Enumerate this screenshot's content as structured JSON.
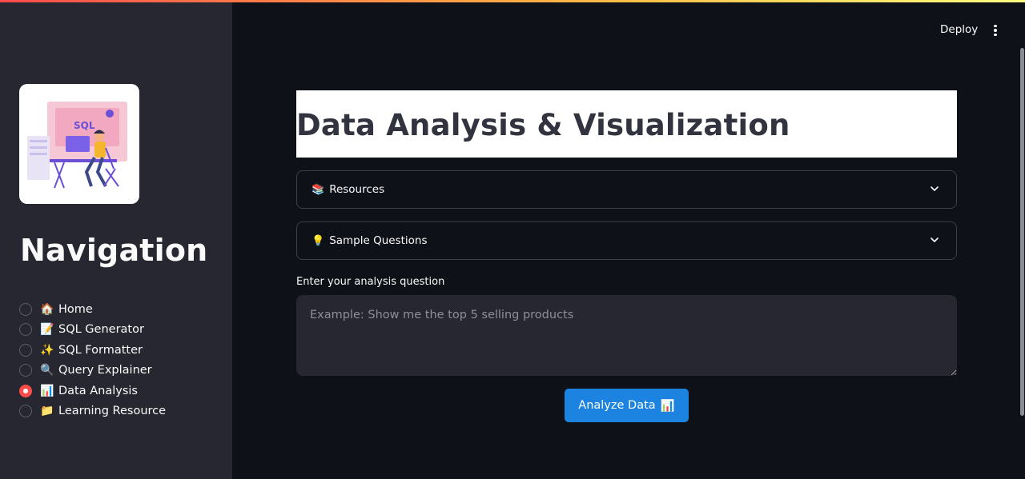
{
  "header": {
    "deploy_label": "Deploy",
    "menu_icon": "kebab-menu-icon"
  },
  "sidebar": {
    "logo_text": "SQL",
    "title": "Navigation",
    "items": [
      {
        "emoji": "🏠",
        "label": "Home",
        "selected": false
      },
      {
        "emoji": "📝",
        "label": "SQL Generator",
        "selected": false
      },
      {
        "emoji": "✨",
        "label": "SQL Formatter",
        "selected": false
      },
      {
        "emoji": "🔍",
        "label": "Query Explainer",
        "selected": false
      },
      {
        "emoji": "📊",
        "label": "Data Analysis",
        "selected": true
      },
      {
        "emoji": "📁",
        "label": "Learning Resource",
        "selected": false
      }
    ]
  },
  "main": {
    "title": "Data Analysis & Visualization",
    "expanders": [
      {
        "emoji": "📚",
        "label": "Resources"
      },
      {
        "emoji": "💡",
        "label": "Sample Questions"
      }
    ],
    "question_label": "Enter your analysis question",
    "question_placeholder": "Example: Show me the top 5 selling products",
    "question_value": "",
    "analyze_button": {
      "label": "Analyze Data",
      "emoji": "📊"
    }
  },
  "colors": {
    "background": "#0e1117",
    "sidebar": "#262730",
    "accent": "#ff4b4b",
    "button": "#1c83e1"
  }
}
